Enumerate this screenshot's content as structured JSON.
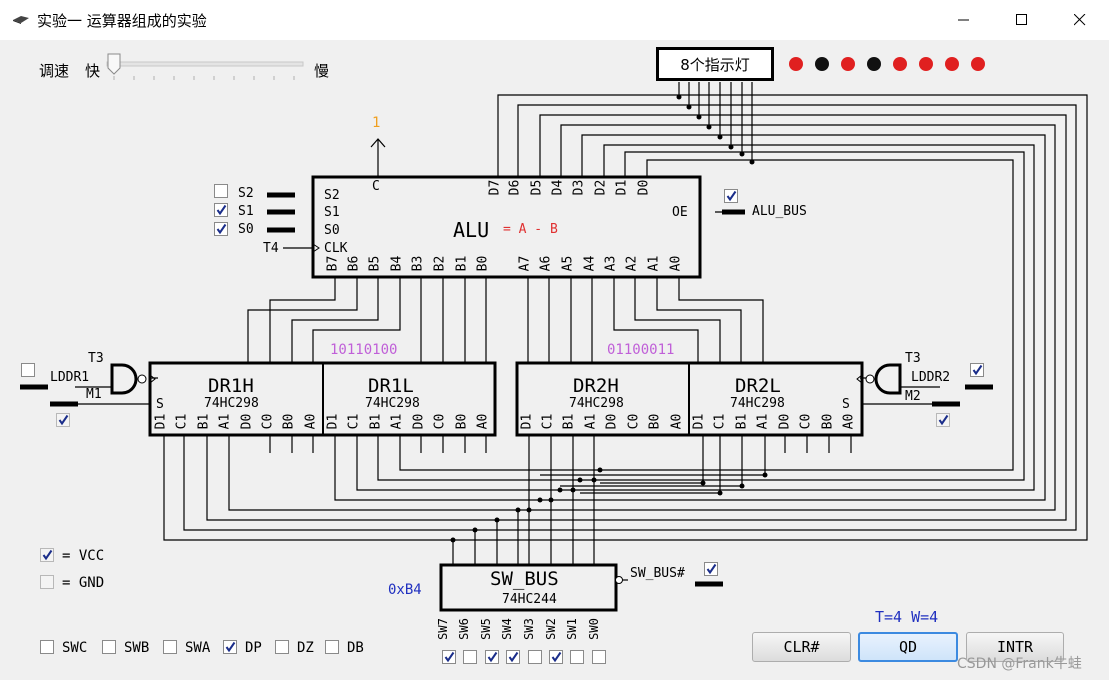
{
  "window": {
    "title": "实验一 运算器组成的实验"
  },
  "speed": {
    "label": "调速",
    "fast": "快",
    "slow": "慢",
    "level": 0
  },
  "indicator": {
    "label": "8个指示灯",
    "leds": [
      "#e02020",
      "#111111",
      "#e02020",
      "#111111",
      "#e02020",
      "#e02020",
      "#e02020",
      "#e02020"
    ]
  },
  "alu": {
    "name": "ALU",
    "op": "= A - B",
    "carry_value": "1",
    "carry_pin": "C",
    "oe_pin": "OE",
    "bus_label": "ALU_BUS",
    "s2": "S2",
    "s1": "S1",
    "s0": "S0",
    "clk": "CLK",
    "t4": "T4",
    "s2_checked": false,
    "s1_checked": true,
    "s0_checked": true,
    "bus_checked": true,
    "d_pins": [
      "D7",
      "D6",
      "D5",
      "D4",
      "D3",
      "D2",
      "D1",
      "D0"
    ],
    "b_pins": [
      "B7",
      "B6",
      "B5",
      "B4",
      "B3",
      "B2",
      "B1",
      "B0"
    ],
    "a_pins": [
      "A7",
      "A6",
      "A5",
      "A4",
      "A3",
      "A2",
      "A1",
      "A0"
    ]
  },
  "dr1": {
    "value": "10110100",
    "h_name": "DR1H",
    "l_name": "DR1L",
    "chip": "74HC298",
    "t3": "T3",
    "load": "LDDR1",
    "m": "M1",
    "s": "S",
    "load_checked": false,
    "m_checked": true,
    "pins": [
      "D1",
      "C1",
      "B1",
      "A1",
      "D0",
      "C0",
      "B0",
      "A0"
    ]
  },
  "dr2": {
    "value": "01100011",
    "h_name": "DR2H",
    "l_name": "DR2L",
    "chip": "74HC298",
    "t3": "T3",
    "load": "LDDR2",
    "m": "M2",
    "s": "S",
    "load_checked": true,
    "m_checked": true,
    "pins": [
      "D1",
      "C1",
      "B1",
      "A1",
      "D0",
      "C0",
      "B0",
      "A0"
    ]
  },
  "swbus": {
    "name": "SW_BUS",
    "chip": "74HC244",
    "hex": "0xB4",
    "enable": "SW_BUS#",
    "enable_checked": true,
    "pins": [
      "SW7",
      "SW6",
      "SW5",
      "SW4",
      "SW3",
      "SW2",
      "SW1",
      "SW0"
    ],
    "switches": [
      true,
      false,
      true,
      true,
      false,
      true,
      false,
      false
    ]
  },
  "legend": {
    "vcc": "= VCC",
    "gnd": "= GND"
  },
  "controls": [
    {
      "label": "SWC",
      "checked": false
    },
    {
      "label": "SWB",
      "checked": false
    },
    {
      "label": "SWA",
      "checked": false
    },
    {
      "label": "DP",
      "checked": true
    },
    {
      "label": "DZ",
      "checked": false
    },
    {
      "label": "DB",
      "checked": false
    }
  ],
  "timing": "T=4 W=4",
  "buttons": {
    "clr": "CLR#",
    "qd": "QD",
    "intr": "INTR"
  },
  "watermark": "CSDN @Frank牛蛙",
  "colors": {
    "orange": "#f0a020",
    "purple": "#c060d8",
    "red": "#e03030",
    "blue": "#2030c0"
  }
}
